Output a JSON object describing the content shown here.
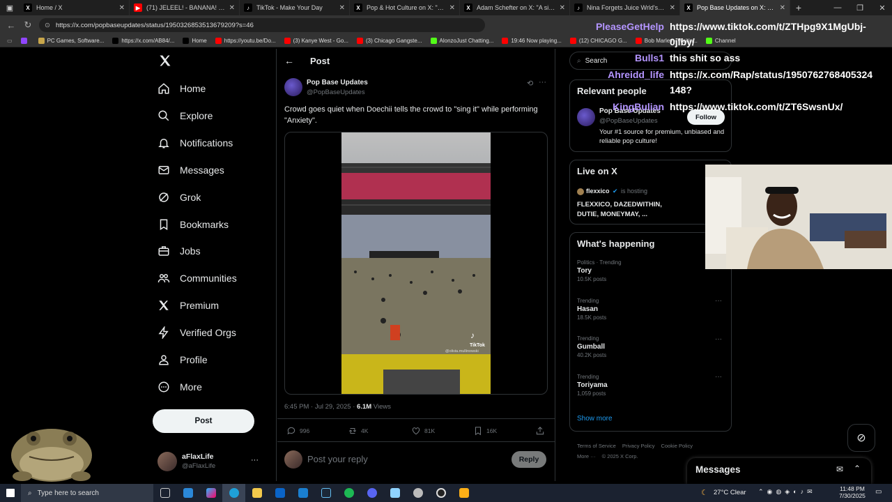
{
  "browser": {
    "tabs": [
      {
        "title": "Home / X",
        "favicon": "X",
        "color": "#000000",
        "active": false
      },
      {
        "title": "(71) JELEEL! - BANANA! (Official V",
        "favicon": "▶",
        "color": "#ff0000",
        "active": false
      },
      {
        "title": "TikTok - Make Your Day",
        "favicon": "♪",
        "color": "#000000",
        "active": false
      },
      {
        "title": "Pop & Hot Culture on X: \"The be",
        "favicon": "X",
        "color": "#000000",
        "active": false
      },
      {
        "title": "Adam Schefter on X: \"A significa",
        "favicon": "X",
        "color": "#000000",
        "active": false
      },
      {
        "title": "Nina Forgets Juice Wrld's Passing",
        "favicon": "♪",
        "color": "#000000",
        "active": false
      },
      {
        "title": "Pop Base Updates on X: \"Cr",
        "favicon": "X",
        "color": "#000000",
        "active": true
      }
    ],
    "url": "https://x.com/popbaseupdates/status/1950326853513679209?s=46",
    "bookmarks": [
      {
        "label": "",
        "color": "#9146ff"
      },
      {
        "label": "PC Games, Software...",
        "color": "#c8a64b"
      },
      {
        "label": "https://x.com/AB84/...",
        "color": "#000000"
      },
      {
        "label": "Home",
        "color": "#000000"
      },
      {
        "label": "https://youtu.be/Do...",
        "color": "#ff0000"
      },
      {
        "label": "(3) Kanye West - Go...",
        "color": "#ff0000"
      },
      {
        "label": "(3) Chicago Gangste...",
        "color": "#ff0000"
      },
      {
        "label": "AlonzoJust Chatting...",
        "color": "#53fc18"
      },
      {
        "label": "19:46 Now playing...",
        "color": "#ff0000"
      },
      {
        "label": "(12) CHICAGO G...",
        "color": "#ff0000"
      },
      {
        "label": "Bob Marley - Waitin...",
        "color": "#ff0000"
      },
      {
        "label": "Channel",
        "color": "#53fc18"
      }
    ]
  },
  "nav": {
    "items": [
      {
        "label": "Home",
        "icon": "home-icon"
      },
      {
        "label": "Explore",
        "icon": "search-icon"
      },
      {
        "label": "Notifications",
        "icon": "bell-icon"
      },
      {
        "label": "Messages",
        "icon": "envelope-icon"
      },
      {
        "label": "Grok",
        "icon": "grok-icon"
      },
      {
        "label": "Bookmarks",
        "icon": "bookmark-icon"
      },
      {
        "label": "Jobs",
        "icon": "briefcase-icon"
      },
      {
        "label": "Communities",
        "icon": "people-icon"
      },
      {
        "label": "Premium",
        "icon": "x-logo-icon"
      },
      {
        "label": "Verified Orgs",
        "icon": "lightning-icon"
      },
      {
        "label": "Profile",
        "icon": "person-icon"
      },
      {
        "label": "More",
        "icon": "more-circle-icon"
      }
    ],
    "post_button": "Post",
    "account": {
      "name": "aFlaxLife",
      "handle": "@aFlaxLife"
    }
  },
  "post": {
    "header": "Post",
    "author": "Pop Base Updates",
    "handle": "@PopBaseUpdates",
    "text": "Crowd goes quiet when Doechii tells the crowd to \"sing it\" while performing \"Anxiety\".",
    "tiktok_label": "TikTok",
    "tiktok_user": "@olivia.mullinowski",
    "timestamp": "6:45 PM · Jul 29, 2025 · ",
    "views_count": "6.1M",
    "views_label": " Views",
    "replies": "996",
    "reposts": "4K",
    "likes": "81K",
    "bookmarks": "16K",
    "reply_placeholder": "Post your reply",
    "reply_button": "Reply"
  },
  "sidebar": {
    "search_placeholder": "Search",
    "relevant_title": "Relevant people",
    "relevant_name": "Pop Base Updates",
    "relevant_handle": "@PopBaseUpdates",
    "relevant_bio": "Your #1 source for premium, unbiased and reliable pop culture!",
    "follow_label": "Follow",
    "live_title": "Live on X",
    "live_host": "flexxico",
    "live_hosting": "is hosting",
    "live_space": "FLEXXICO, DAZEDWITHIN, DUTIE, MONEYMAY, ...",
    "happening_title": "What's happening",
    "trends": [
      {
        "category": "Politics · Trending",
        "name": "Tory",
        "posts": "10.5K posts"
      },
      {
        "category": "Trending",
        "name": "Hasan",
        "posts": "18.5K posts"
      },
      {
        "category": "Trending",
        "name": "Gumball",
        "posts": "40.2K posts"
      },
      {
        "category": "Trending",
        "name": "Toriyama",
        "posts": "1,059 posts"
      }
    ],
    "show_more": "Show more",
    "footer": [
      "Terms of Service",
      "Privacy Policy",
      "Cookie Policy",
      "More ···",
      "© 2025 X Corp."
    ],
    "messages_label": "Messages"
  },
  "chat": [
    {
      "user": "PleaseGetHelp",
      "message": "https://www.tiktok.com/t/ZTHpg9X1MgUbj-"
    },
    {
      "user": "",
      "message": "0jlby/"
    },
    {
      "user": "Bulls1",
      "message": "this shit so ass"
    },
    {
      "user": "Ahreidd_life",
      "message": "https://x.com/Rap/status/1950762768405324"
    },
    {
      "user": "",
      "message": "148?"
    },
    {
      "user": "KingBulian",
      "message": "https://www.tiktok.com/t/ZT6SwsnUx/"
    }
  ],
  "taskbar": {
    "search_placeholder": "Type here to search",
    "weather": "27°C  Clear",
    "time": "11:48 PM",
    "date": "7/30/2025"
  },
  "colors": {
    "accent": "#1d9bf0",
    "chat_name": "#b495ff",
    "background": "#000000"
  }
}
